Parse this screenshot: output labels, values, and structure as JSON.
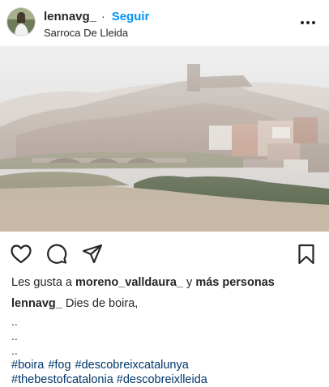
{
  "post": {
    "username": "lennavg_",
    "separator": "·",
    "follow_label": "Seguir",
    "location": "Sarroca De Lleida",
    "more_icon": "more-horizontal-icon"
  },
  "actions": {
    "like_icon": "heart-outline-icon",
    "comment_icon": "comment-bubble-icon",
    "share_icon": "paper-plane-icon",
    "save_icon": "bookmark-outline-icon"
  },
  "likes": {
    "prefix": "Les gusta a",
    "user": "moreno_valldaura_",
    "connector": "y",
    "others": "más personas"
  },
  "caption": {
    "username": "lennavg_",
    "text": "Dies de boira,",
    "lines": [
      "..",
      "..",
      ".."
    ],
    "hashtags": [
      "#boira",
      "#fog",
      "#descobreixcatalunya"
    ],
    "hashtags_more": "#thebestofcatalonia #descobreixlleida"
  },
  "colors": {
    "link_blue": "#0095f6",
    "hashtag_blue": "#00376b",
    "text": "#262626"
  }
}
